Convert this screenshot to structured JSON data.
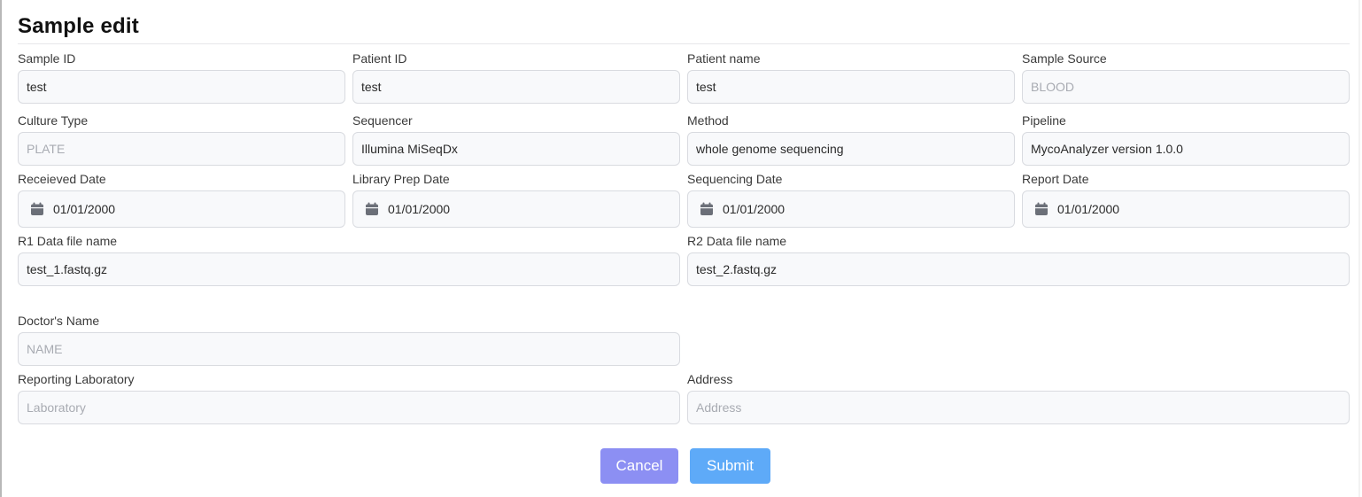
{
  "title": "Sample edit",
  "fields": {
    "sample_id": {
      "label": "Sample ID",
      "value": "test"
    },
    "patient_id": {
      "label": "Patient ID",
      "value": "test"
    },
    "patient_name": {
      "label": "Patient name",
      "value": "test"
    },
    "sample_source": {
      "label": "Sample Source",
      "placeholder": "BLOOD"
    },
    "culture_type": {
      "label": "Culture Type",
      "placeholder": "PLATE"
    },
    "sequencer": {
      "label": "Sequencer",
      "value": "Illumina MiSeqDx"
    },
    "method": {
      "label": "Method",
      "value": "whole genome sequencing"
    },
    "pipeline": {
      "label": "Pipeline",
      "value": "MycoAnalyzer version 1.0.0"
    },
    "received_date": {
      "label": "Receieved Date",
      "value": "01/01/2000"
    },
    "library_prep_date": {
      "label": "Library Prep Date",
      "value": "01/01/2000"
    },
    "sequencing_date": {
      "label": "Sequencing Date",
      "value": "01/01/2000"
    },
    "report_date": {
      "label": "Report Date",
      "value": "01/01/2000"
    },
    "r1_file": {
      "label": "R1 Data file name",
      "value": "test_1.fastq.gz"
    },
    "r2_file": {
      "label": "R2 Data file name",
      "value": "test_2.fastq.gz"
    },
    "doctor_name": {
      "label": "Doctor's Name",
      "placeholder": "NAME"
    },
    "reporting_lab": {
      "label": "Reporting Laboratory",
      "placeholder": "Laboratory"
    },
    "address": {
      "label": "Address",
      "placeholder": "Address"
    }
  },
  "buttons": {
    "cancel": "Cancel",
    "submit": "Submit"
  },
  "colors": {
    "cancel_button": "#8c8ff3",
    "submit_button": "#5eaaf8",
    "field_background": "#f8f9fb",
    "field_border": "#d9dbe0",
    "calendar_icon": "#6b6f78"
  },
  "icons": {
    "date_field_icon": "calendar-icon"
  }
}
